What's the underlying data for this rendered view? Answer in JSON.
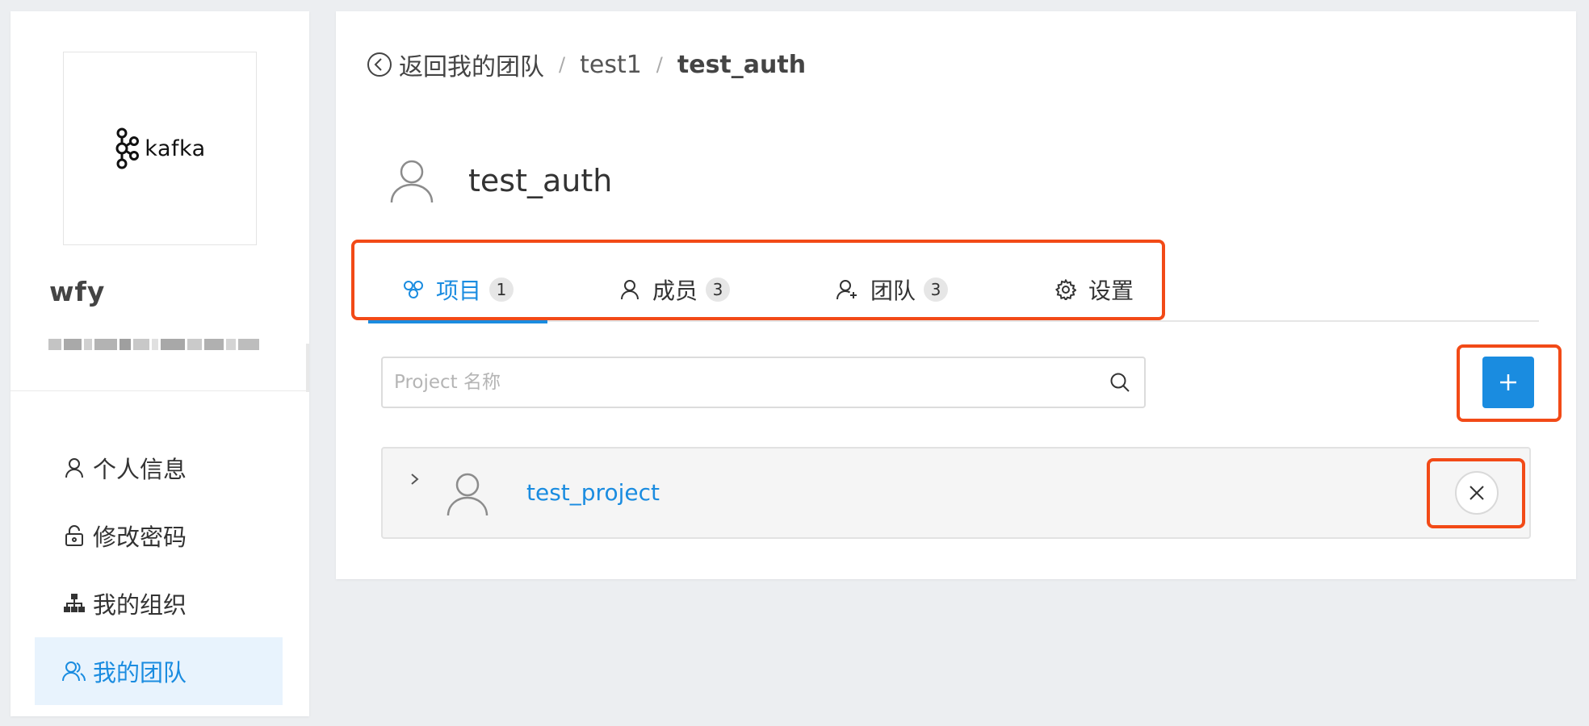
{
  "sidebar": {
    "logo_text": "kafka",
    "username": "wfy",
    "menu": [
      {
        "label": "个人信息",
        "icon": "user-icon"
      },
      {
        "label": "修改密码",
        "icon": "lock-icon"
      },
      {
        "label": "我的组织",
        "icon": "org-icon"
      },
      {
        "label": "我的团队",
        "icon": "team-icon",
        "active": true
      }
    ]
  },
  "breadcrumb": {
    "back_label": "返回我的团队",
    "separator": "/",
    "level1": "test1",
    "current": "test_auth"
  },
  "team": {
    "title": "test_auth"
  },
  "tabs": [
    {
      "label": "项目",
      "count": "1",
      "icon": "project-icon",
      "active": true
    },
    {
      "label": "成员",
      "count": "3",
      "icon": "user-icon"
    },
    {
      "label": "团队",
      "count": "3",
      "icon": "add-user-icon"
    },
    {
      "label": "设置",
      "icon": "gear-icon"
    }
  ],
  "search": {
    "placeholder": "Project 名称",
    "value": ""
  },
  "projects": [
    {
      "name": "test_project"
    }
  ],
  "colors": {
    "accent": "#1a8ce0",
    "highlight": "#f24a17"
  }
}
